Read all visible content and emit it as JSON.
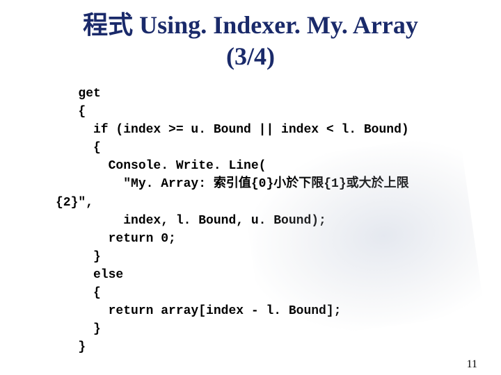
{
  "title_line1": "程式 Using. Indexer. My. Array",
  "title_line2": "(3/4)",
  "code": "   get\n   {\n     if (index >= u. Bound || index < l. Bound)\n     {\n       Console. Write. Line(\n         \"My. Array: 索引值{0}小於下限{1}或大於上限\n{2}\",\n         index, l. Bound, u. Bound);\n       return 0;\n     }\n     else\n     {\n       return array[index - l. Bound];\n     }\n   }",
  "page_number": "11"
}
